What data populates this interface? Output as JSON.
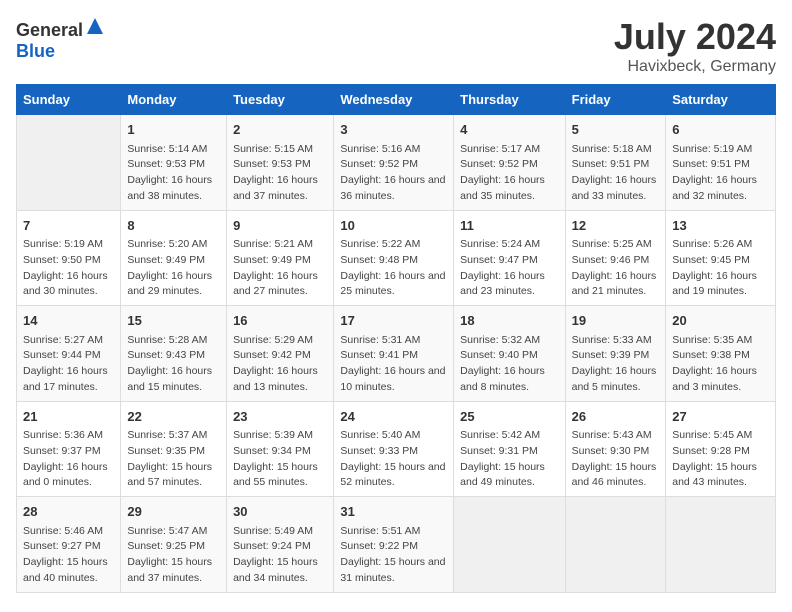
{
  "logo": {
    "text_general": "General",
    "text_blue": "Blue"
  },
  "title": {
    "month_year": "July 2024",
    "location": "Havixbeck, Germany"
  },
  "weekdays": [
    "Sunday",
    "Monday",
    "Tuesday",
    "Wednesday",
    "Thursday",
    "Friday",
    "Saturday"
  ],
  "weeks": [
    [
      {
        "day": "",
        "empty": true
      },
      {
        "day": "1",
        "sunrise": "Sunrise: 5:14 AM",
        "sunset": "Sunset: 9:53 PM",
        "daylight": "Daylight: 16 hours and 38 minutes."
      },
      {
        "day": "2",
        "sunrise": "Sunrise: 5:15 AM",
        "sunset": "Sunset: 9:53 PM",
        "daylight": "Daylight: 16 hours and 37 minutes."
      },
      {
        "day": "3",
        "sunrise": "Sunrise: 5:16 AM",
        "sunset": "Sunset: 9:52 PM",
        "daylight": "Daylight: 16 hours and 36 minutes."
      },
      {
        "day": "4",
        "sunrise": "Sunrise: 5:17 AM",
        "sunset": "Sunset: 9:52 PM",
        "daylight": "Daylight: 16 hours and 35 minutes."
      },
      {
        "day": "5",
        "sunrise": "Sunrise: 5:18 AM",
        "sunset": "Sunset: 9:51 PM",
        "daylight": "Daylight: 16 hours and 33 minutes."
      },
      {
        "day": "6",
        "sunrise": "Sunrise: 5:19 AM",
        "sunset": "Sunset: 9:51 PM",
        "daylight": "Daylight: 16 hours and 32 minutes."
      }
    ],
    [
      {
        "day": "7",
        "sunrise": "Sunrise: 5:19 AM",
        "sunset": "Sunset: 9:50 PM",
        "daylight": "Daylight: 16 hours and 30 minutes."
      },
      {
        "day": "8",
        "sunrise": "Sunrise: 5:20 AM",
        "sunset": "Sunset: 9:49 PM",
        "daylight": "Daylight: 16 hours and 29 minutes."
      },
      {
        "day": "9",
        "sunrise": "Sunrise: 5:21 AM",
        "sunset": "Sunset: 9:49 PM",
        "daylight": "Daylight: 16 hours and 27 minutes."
      },
      {
        "day": "10",
        "sunrise": "Sunrise: 5:22 AM",
        "sunset": "Sunset: 9:48 PM",
        "daylight": "Daylight: 16 hours and 25 minutes."
      },
      {
        "day": "11",
        "sunrise": "Sunrise: 5:24 AM",
        "sunset": "Sunset: 9:47 PM",
        "daylight": "Daylight: 16 hours and 23 minutes."
      },
      {
        "day": "12",
        "sunrise": "Sunrise: 5:25 AM",
        "sunset": "Sunset: 9:46 PM",
        "daylight": "Daylight: 16 hours and 21 minutes."
      },
      {
        "day": "13",
        "sunrise": "Sunrise: 5:26 AM",
        "sunset": "Sunset: 9:45 PM",
        "daylight": "Daylight: 16 hours and 19 minutes."
      }
    ],
    [
      {
        "day": "14",
        "sunrise": "Sunrise: 5:27 AM",
        "sunset": "Sunset: 9:44 PM",
        "daylight": "Daylight: 16 hours and 17 minutes."
      },
      {
        "day": "15",
        "sunrise": "Sunrise: 5:28 AM",
        "sunset": "Sunset: 9:43 PM",
        "daylight": "Daylight: 16 hours and 15 minutes."
      },
      {
        "day": "16",
        "sunrise": "Sunrise: 5:29 AM",
        "sunset": "Sunset: 9:42 PM",
        "daylight": "Daylight: 16 hours and 13 minutes."
      },
      {
        "day": "17",
        "sunrise": "Sunrise: 5:31 AM",
        "sunset": "Sunset: 9:41 PM",
        "daylight": "Daylight: 16 hours and 10 minutes."
      },
      {
        "day": "18",
        "sunrise": "Sunrise: 5:32 AM",
        "sunset": "Sunset: 9:40 PM",
        "daylight": "Daylight: 16 hours and 8 minutes."
      },
      {
        "day": "19",
        "sunrise": "Sunrise: 5:33 AM",
        "sunset": "Sunset: 9:39 PM",
        "daylight": "Daylight: 16 hours and 5 minutes."
      },
      {
        "day": "20",
        "sunrise": "Sunrise: 5:35 AM",
        "sunset": "Sunset: 9:38 PM",
        "daylight": "Daylight: 16 hours and 3 minutes."
      }
    ],
    [
      {
        "day": "21",
        "sunrise": "Sunrise: 5:36 AM",
        "sunset": "Sunset: 9:37 PM",
        "daylight": "Daylight: 16 hours and 0 minutes."
      },
      {
        "day": "22",
        "sunrise": "Sunrise: 5:37 AM",
        "sunset": "Sunset: 9:35 PM",
        "daylight": "Daylight: 15 hours and 57 minutes."
      },
      {
        "day": "23",
        "sunrise": "Sunrise: 5:39 AM",
        "sunset": "Sunset: 9:34 PM",
        "daylight": "Daylight: 15 hours and 55 minutes."
      },
      {
        "day": "24",
        "sunrise": "Sunrise: 5:40 AM",
        "sunset": "Sunset: 9:33 PM",
        "daylight": "Daylight: 15 hours and 52 minutes."
      },
      {
        "day": "25",
        "sunrise": "Sunrise: 5:42 AM",
        "sunset": "Sunset: 9:31 PM",
        "daylight": "Daylight: 15 hours and 49 minutes."
      },
      {
        "day": "26",
        "sunrise": "Sunrise: 5:43 AM",
        "sunset": "Sunset: 9:30 PM",
        "daylight": "Daylight: 15 hours and 46 minutes."
      },
      {
        "day": "27",
        "sunrise": "Sunrise: 5:45 AM",
        "sunset": "Sunset: 9:28 PM",
        "daylight": "Daylight: 15 hours and 43 minutes."
      }
    ],
    [
      {
        "day": "28",
        "sunrise": "Sunrise: 5:46 AM",
        "sunset": "Sunset: 9:27 PM",
        "daylight": "Daylight: 15 hours and 40 minutes."
      },
      {
        "day": "29",
        "sunrise": "Sunrise: 5:47 AM",
        "sunset": "Sunset: 9:25 PM",
        "daylight": "Daylight: 15 hours and 37 minutes."
      },
      {
        "day": "30",
        "sunrise": "Sunrise: 5:49 AM",
        "sunset": "Sunset: 9:24 PM",
        "daylight": "Daylight: 15 hours and 34 minutes."
      },
      {
        "day": "31",
        "sunrise": "Sunrise: 5:51 AM",
        "sunset": "Sunset: 9:22 PM",
        "daylight": "Daylight: 15 hours and 31 minutes."
      },
      {
        "day": "",
        "empty": true
      },
      {
        "day": "",
        "empty": true
      },
      {
        "day": "",
        "empty": true
      }
    ]
  ]
}
